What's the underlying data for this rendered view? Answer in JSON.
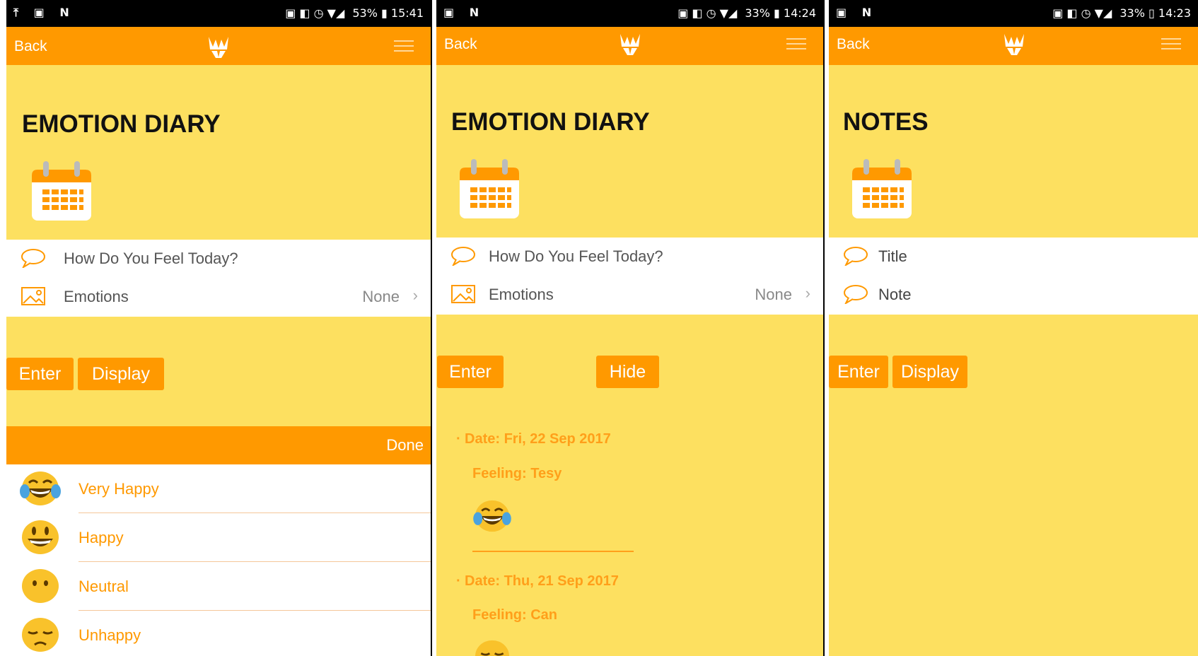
{
  "screens": [
    {
      "status": {
        "left_icons": "⤒ ▣ N",
        "battery": "53%",
        "time": "15:41"
      },
      "back_label": "Back",
      "title": "EMOTION DIARY",
      "card": {
        "row1_label": "How Do You Feel Today?",
        "row2_label": "Emotions",
        "row2_value": "None"
      },
      "buttons": {
        "enter": "Enter",
        "second": "Display"
      },
      "picker": {
        "done_label": "Done",
        "options": [
          "Very Happy",
          "Happy",
          "Neutral",
          "Unhappy"
        ]
      }
    },
    {
      "status": {
        "left_icons": "▣ N",
        "battery": "33%",
        "time": "14:24"
      },
      "back_label": "Back",
      "title": "EMOTION DIARY",
      "card": {
        "row1_label": "How Do You Feel Today?",
        "row2_label": "Emotions",
        "row2_value": "None"
      },
      "buttons": {
        "enter": "Enter",
        "second": "Hide"
      },
      "entries": [
        {
          "date": "Date: Fri, 22 Sep 2017",
          "feeling": "Feeling: Tesy"
        },
        {
          "date": "Date: Thu, 21 Sep 2017",
          "feeling": "Feeling: Can"
        }
      ]
    },
    {
      "status": {
        "left_icons": "▣ N",
        "battery": "33%",
        "time": "14:23"
      },
      "back_label": "Back",
      "title": "NOTES",
      "card": {
        "row1_label": "Title",
        "row2_label": "Note"
      },
      "buttons": {
        "enter": "Enter",
        "second": "Display"
      }
    }
  ],
  "colors": {
    "accent": "#ff9900",
    "background": "#fde060",
    "entry_text": "#ff9f1a"
  },
  "icons": [
    "calendar-icon",
    "speech-bubble-icon",
    "image-icon",
    "chevron-right-icon",
    "menu-icon",
    "app-logo-icon"
  ]
}
